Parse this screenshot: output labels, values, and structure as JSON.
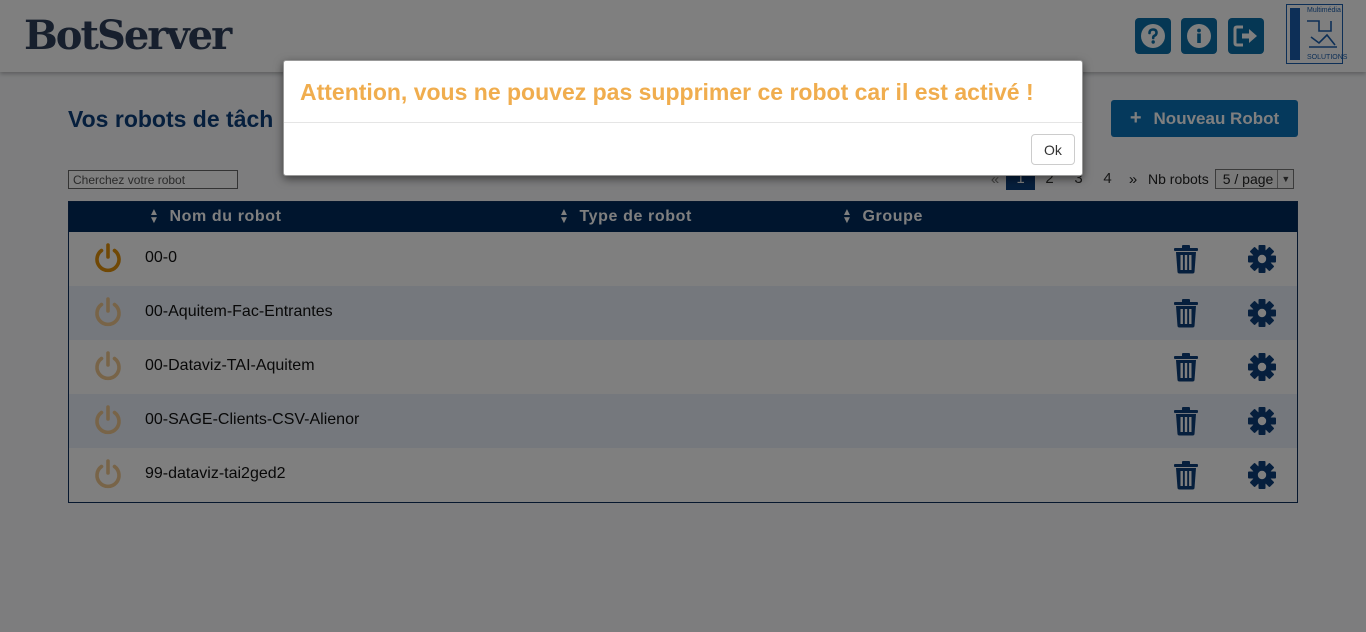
{
  "header": {
    "logo_text": "BotServer",
    "help_icon": "question-circle-icon",
    "info_icon": "info-circle-icon",
    "logout_icon": "sign-out-icon",
    "brand_top": "Multimédia",
    "brand_bottom": "SOLUTIONS"
  },
  "page": {
    "title": "Vos robots de tâch",
    "new_button_label": "Nouveau Robot",
    "search_placeholder": "Cherchez votre robot"
  },
  "pagination": {
    "prev": "«",
    "pages": [
      "1",
      "2",
      "3",
      "4"
    ],
    "active_page": "1",
    "next": "»",
    "nb_label": "Nb robots",
    "per_page_value": "5 / page"
  },
  "table": {
    "headers": [
      "Nom du robot",
      "Type de robot",
      "Groupe"
    ],
    "rows": [
      {
        "name": "00-0",
        "active": true
      },
      {
        "name": "00-Aquitem-Fac-Entrantes",
        "active": false
      },
      {
        "name": "00-Dataviz-TAI-Aquitem",
        "active": false
      },
      {
        "name": "00-SAGE-Clients-CSV-Alienor",
        "active": false
      },
      {
        "name": "99-dataviz-tai2ged2",
        "active": false
      }
    ]
  },
  "modal": {
    "title": "Attention, vous ne pouvez pas supprimer ce robot car il est activé !",
    "ok_label": "Ok"
  },
  "colors": {
    "navy": "#002a5c",
    "accent_blue": "#0a72b8",
    "warning_orange": "#f0ad4e",
    "power_active": "#e0900a",
    "power_inactive": "#f0c890"
  }
}
